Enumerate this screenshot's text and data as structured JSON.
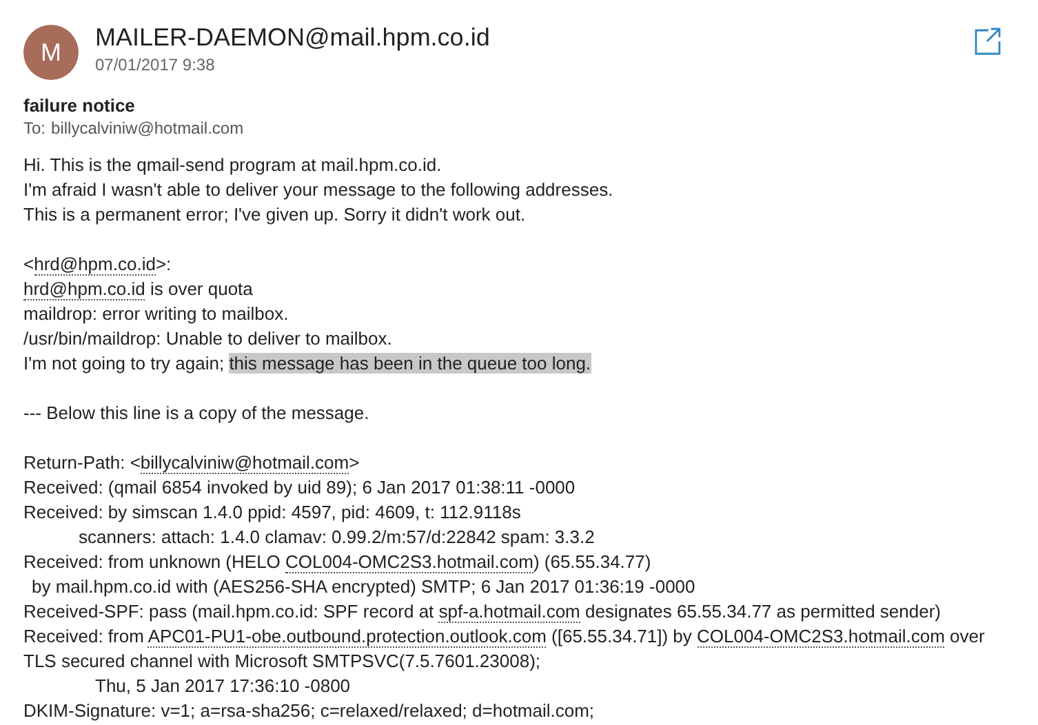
{
  "sender": {
    "initial": "M",
    "address": "MAILER-DAEMON@mail.hpm.co.id",
    "date": "07/01/2017 9:38"
  },
  "subject": "failure notice",
  "to": {
    "label": "To:",
    "address": "billycalviniw@hotmail.com"
  },
  "body": [
    {
      "kind": "text",
      "segments": [
        {
          "kind": "plain",
          "text": "Hi. This is the qmail-send program at mail.hpm.co.id."
        }
      ]
    },
    {
      "kind": "text",
      "segments": [
        {
          "kind": "plain",
          "text": "I'm afraid I wasn't able to deliver your message to the following addresses."
        }
      ]
    },
    {
      "kind": "text",
      "segments": [
        {
          "kind": "plain",
          "text": "This is a permanent error; I've given up. Sorry it didn't work out."
        }
      ]
    },
    {
      "kind": "blank"
    },
    {
      "kind": "text",
      "segments": [
        {
          "kind": "plain",
          "text": "<"
        },
        {
          "kind": "link",
          "text": "hrd@hpm.co.id"
        },
        {
          "kind": "plain",
          "text": ">:"
        }
      ]
    },
    {
      "kind": "text",
      "segments": [
        {
          "kind": "link",
          "text": "hrd@hpm.co.id"
        },
        {
          "kind": "plain",
          "text": " is over quota"
        }
      ]
    },
    {
      "kind": "text",
      "segments": [
        {
          "kind": "plain",
          "text": "maildrop: error writing to mailbox."
        }
      ]
    },
    {
      "kind": "text",
      "segments": [
        {
          "kind": "plain",
          "text": "/usr/bin/maildrop: Unable to deliver to mailbox."
        }
      ]
    },
    {
      "kind": "text",
      "segments": [
        {
          "kind": "plain",
          "text": "I'm not going to try again; "
        },
        {
          "kind": "highlight",
          "text": "this message has been in the queue too long."
        }
      ]
    },
    {
      "kind": "blank"
    },
    {
      "kind": "text",
      "segments": [
        {
          "kind": "plain",
          "text": "--- Below this line is a copy of the message."
        }
      ]
    },
    {
      "kind": "blank"
    },
    {
      "kind": "text",
      "segments": [
        {
          "kind": "plain",
          "text": "Return-Path: <"
        },
        {
          "kind": "link",
          "text": "billycalviniw@hotmail.com"
        },
        {
          "kind": "plain",
          "text": ">"
        }
      ]
    },
    {
      "kind": "text",
      "segments": [
        {
          "kind": "plain",
          "text": "Received: (qmail 6854 invoked by uid 89); 6 Jan 2017 01:38:11 -0000"
        }
      ]
    },
    {
      "kind": "text",
      "segments": [
        {
          "kind": "plain",
          "text": "Received: by simscan 1.4.0 ppid: 4597, pid: 4609, t: 112.9118s"
        }
      ]
    },
    {
      "kind": "tabbed",
      "segments": [
        {
          "kind": "plain",
          "text": "scanners: attach: 1.4.0 clamav: 0.99.2/m:57/d:22842 spam: 3.3.2"
        }
      ]
    },
    {
      "kind": "text",
      "segments": [
        {
          "kind": "plain",
          "text": "Received: from unknown (HELO "
        },
        {
          "kind": "link",
          "text": "COL004-OMC2S3.hotmail.com"
        },
        {
          "kind": "plain",
          "text": ") (65.55.34.77)"
        }
      ]
    },
    {
      "kind": "continued",
      "segments": [
        {
          "kind": "plain",
          "text": "by mail.hpm.co.id with (AES256-SHA encrypted) SMTP; 6 Jan 2017 01:36:19 -0000"
        }
      ]
    },
    {
      "kind": "text",
      "segments": [
        {
          "kind": "plain",
          "text": "Received-SPF: pass (mail.hpm.co.id: SPF record at "
        },
        {
          "kind": "link",
          "text": "spf-a.hotmail.com"
        },
        {
          "kind": "plain",
          "text": " designates 65.55.34.77 as permitted sender)"
        }
      ]
    },
    {
      "kind": "text",
      "segments": [
        {
          "kind": "plain",
          "text": "Received: from "
        },
        {
          "kind": "link",
          "text": "APC01-PU1-obe.outbound.protection.outlook.com"
        },
        {
          "kind": "plain",
          "text": " ([65.55.34.71]) by "
        },
        {
          "kind": "link",
          "text": "COL004-OMC2S3.hotmail.com"
        },
        {
          "kind": "plain",
          "text": " over"
        }
      ]
    },
    {
      "kind": "text",
      "segments": [
        {
          "kind": "plain",
          "text": "TLS secured channel with Microsoft SMTPSVC(7.5.7601.23008);"
        }
      ]
    },
    {
      "kind": "deep",
      "segments": [
        {
          "kind": "plain",
          "text": "Thu, 5 Jan 2017 17:36:10 -0800"
        }
      ]
    },
    {
      "kind": "text",
      "segments": [
        {
          "kind": "plain",
          "text": "DKIM-Signature: v=1; a=rsa-sha256; c=relaxed/relaxed; d=hotmail.com;"
        }
      ]
    }
  ]
}
